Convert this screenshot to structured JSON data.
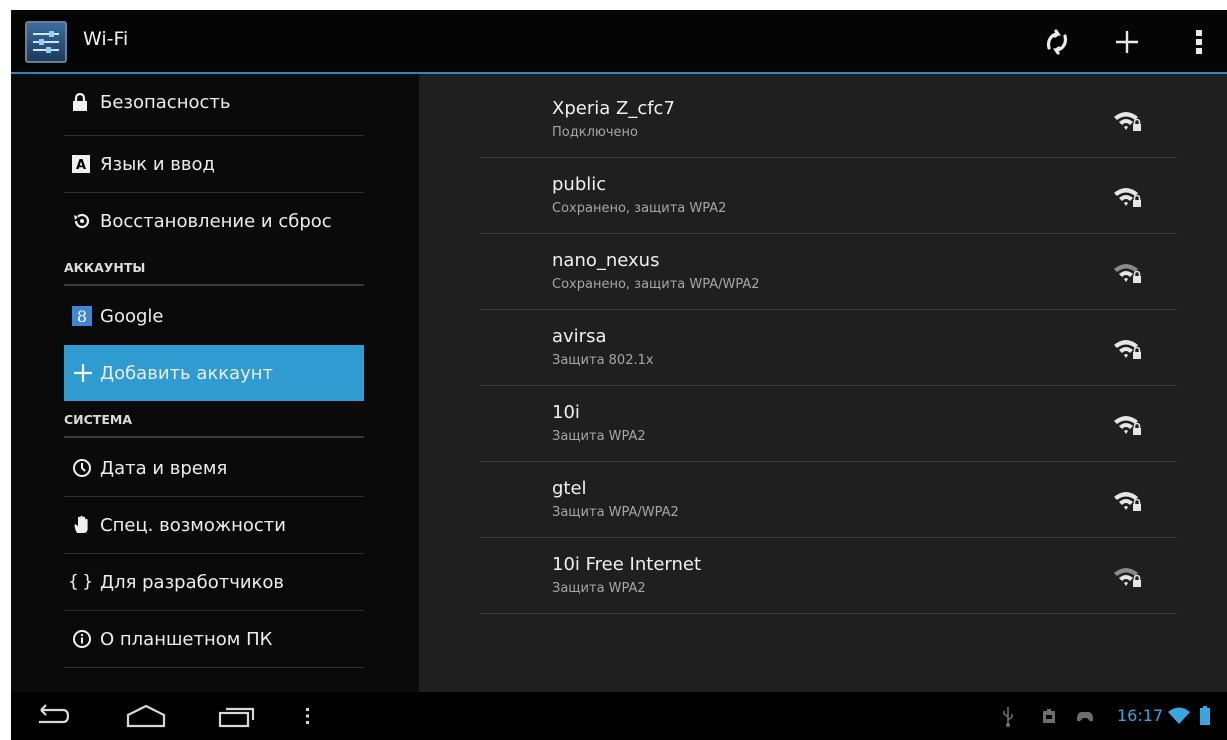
{
  "actionbar": {
    "title": "Wi-Fi",
    "icons": [
      "settings-app-icon",
      "wps-icon",
      "add-network-icon",
      "overflow-menu-icon"
    ]
  },
  "sidebar": {
    "items": [
      {
        "label": "Безопасность",
        "icon": "lock-icon"
      },
      {
        "label": "Язык и ввод",
        "icon": "keyboard-a-icon"
      },
      {
        "label": "Восстановление и сброс",
        "icon": "restore-icon"
      }
    ],
    "accounts_header": "АККАУНТЫ",
    "accounts": [
      {
        "label": "Google",
        "icon": "google-icon"
      },
      {
        "label": "Добавить аккаунт",
        "icon": "plus-icon",
        "selected": true
      }
    ],
    "system_header": "СИСТЕМА",
    "system": [
      {
        "label": "Дата и время",
        "icon": "clock-icon"
      },
      {
        "label": "Спец. возможности",
        "icon": "hand-icon"
      },
      {
        "label": "Для разработчиков",
        "icon": "braces-icon"
      },
      {
        "label": "О планшетном ПК",
        "icon": "info-icon"
      }
    ]
  },
  "networks": [
    {
      "ssid": "Xperia Z_cfc7",
      "status": "Подключено",
      "secured": true
    },
    {
      "ssid": "public",
      "status": "Сохранено, защита WPA2",
      "secured": true
    },
    {
      "ssid": "nano_nexus",
      "status": "Сохранено, защита WPA/WPA2",
      "secured": true
    },
    {
      "ssid": "avirsa",
      "status": "Защита 802.1x",
      "secured": true
    },
    {
      "ssid": "10i",
      "status": "Защита WPA2",
      "secured": true
    },
    {
      "ssid": "gtel",
      "status": "Защита WPA/WPA2",
      "secured": true
    },
    {
      "ssid": "10i Free Internet",
      "status": "Защита WPA2",
      "secured": true
    }
  ],
  "statusbar": {
    "time": "16:17",
    "icons": [
      "usb-icon",
      "sd-card-icon",
      "game-controller-icon",
      "wifi-status-icon",
      "battery-icon"
    ]
  },
  "navbar": {
    "icons": [
      "back-icon",
      "home-icon",
      "recents-icon",
      "menu-dots-icon"
    ]
  },
  "colors": {
    "accent": "#2f9bd0",
    "clock": "#39a6df",
    "background": "#1f1f1f"
  }
}
